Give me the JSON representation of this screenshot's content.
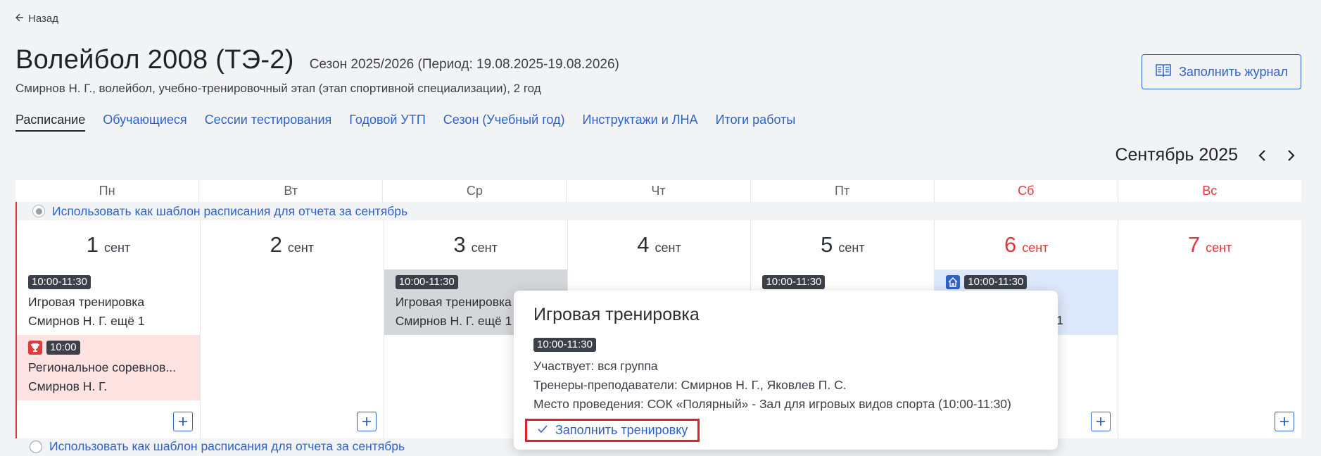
{
  "back": {
    "label": "Назад"
  },
  "header": {
    "title": "Волейбол 2008 (ТЭ-2)",
    "season": "Сезон 2025/2026 (Период: 19.08.2025-19.08.2026)",
    "subtitle": "Смирнов Н. Г., волейбол, учебно-тренировочный этап (этап спортивной специализации), 2 год",
    "journal_button": "Заполнить журнал"
  },
  "tabs": [
    {
      "label": "Расписание",
      "active": true
    },
    {
      "label": "Обучающиеся"
    },
    {
      "label": "Сессии тестирования"
    },
    {
      "label": "Годовой УТП"
    },
    {
      "label": "Сезон (Учебный год)"
    },
    {
      "label": "Инструктажи и ЛНА"
    },
    {
      "label": "Итоги работы"
    }
  ],
  "calendar": {
    "month_label": "Сентябрь 2025",
    "weekdays": [
      "Пн",
      "Вт",
      "Ср",
      "Чт",
      "Пт",
      "Сб",
      "Вс"
    ],
    "template_label": "Использовать как шаблон расписания для отчета за сентябрь",
    "days": [
      {
        "num": "1",
        "mon": "сент"
      },
      {
        "num": "2",
        "mon": "сент"
      },
      {
        "num": "3",
        "mon": "сент"
      },
      {
        "num": "4",
        "mon": "сент"
      },
      {
        "num": "5",
        "mon": "сент"
      },
      {
        "num": "6",
        "mon": "сент"
      },
      {
        "num": "7",
        "mon": "сент"
      }
    ],
    "events": {
      "mon_training": {
        "time": "10:00-11:30",
        "name": "Игровая тренировка",
        "coach": "Смирнов Н. Г. ещё 1"
      },
      "mon_competition": {
        "time": "10:00",
        "name": "Региональное соревнов...",
        "coach": "Смирнов Н. Г.",
        "icon": "trophy-icon"
      },
      "wed_training": {
        "time": "10:00-11:30",
        "name": "Игровая тренировка",
        "coach": "Смирнов Н. Г. ещё 1"
      },
      "fri_training": {
        "time": "10:00-11:30"
      },
      "sat_training": {
        "time": "10:00-11:30",
        "coach_tail": "1",
        "icon": "home-icon"
      }
    }
  },
  "popup": {
    "title": "Игровая тренировка",
    "time": "10:00-11:30",
    "participants": "Участвует: вся группа",
    "coaches": "Тренеры-преподаватели: Смирнов Н. Г., Яковлев П. С.",
    "place": "Место проведения: СОК «Полярный» - Зал для игровых видов спорта (10:00-11:30)",
    "fill_button": "Заполнить тренировку"
  },
  "colors": {
    "accent": "#2d63c8",
    "weekend": "#e0393e",
    "highlight": "#e0202a"
  }
}
